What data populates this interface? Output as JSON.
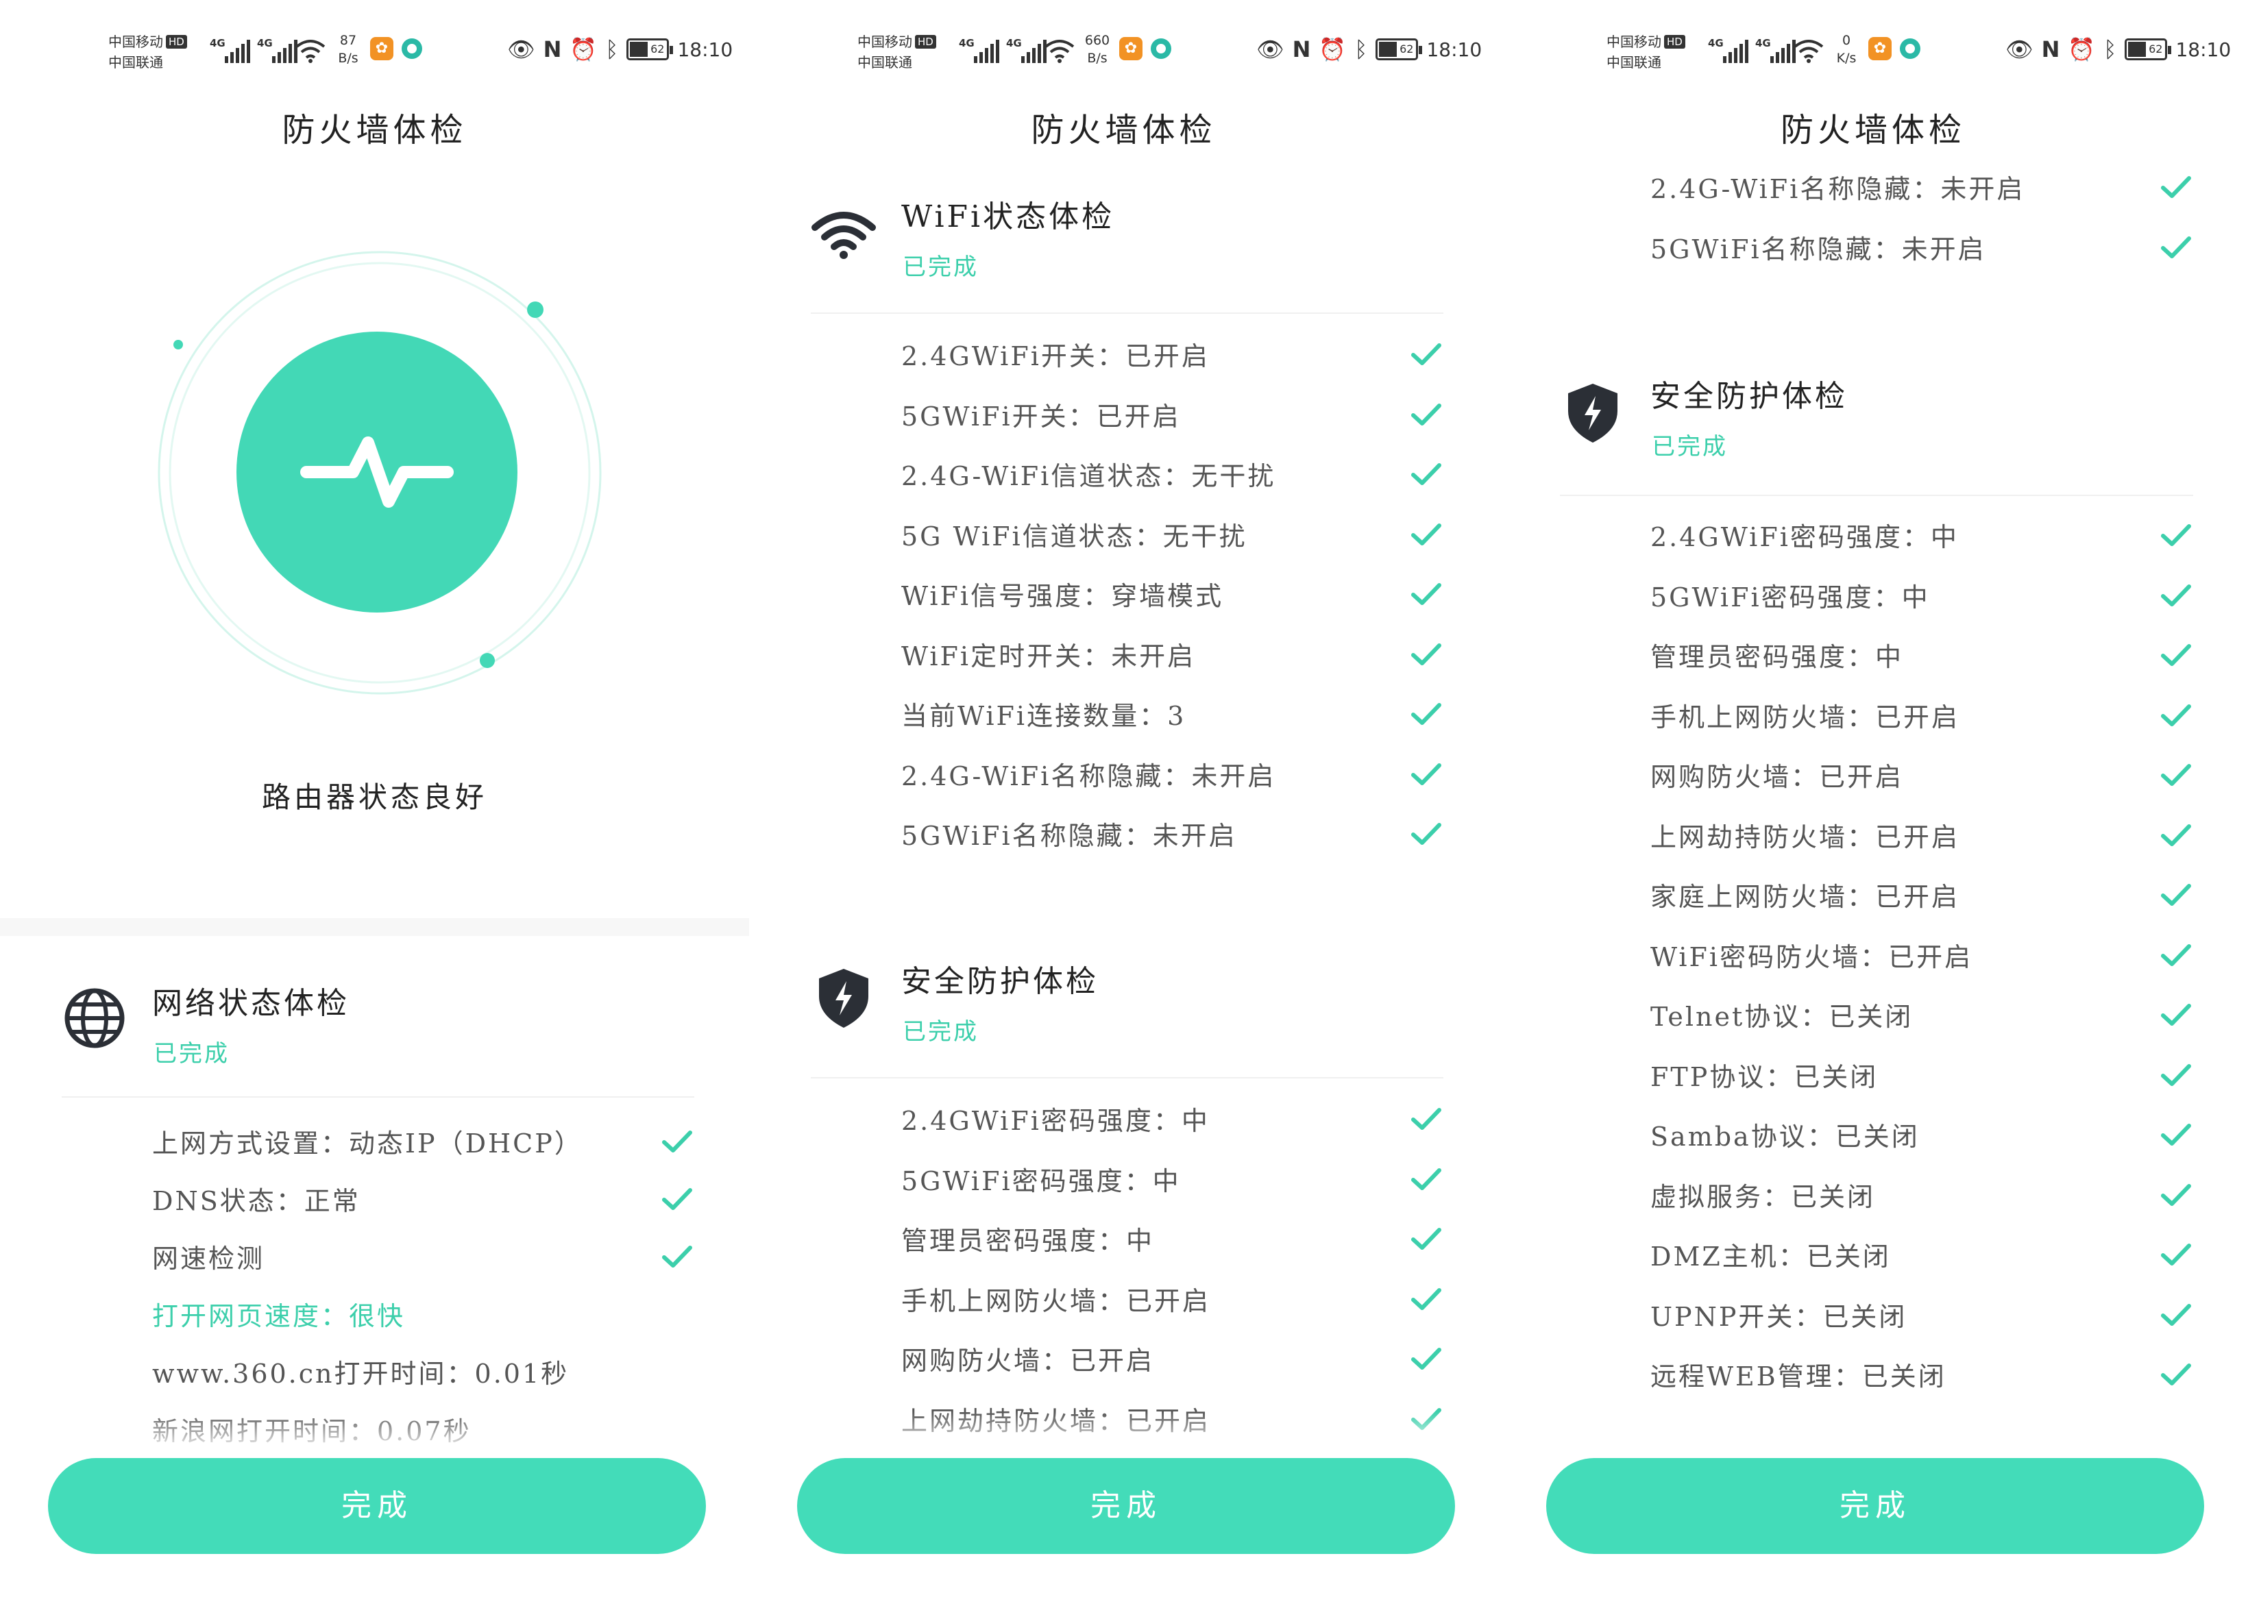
{
  "colors": {
    "accent": "#43d8b6",
    "accent_text": "#3ccfab",
    "check": "#3ccfab",
    "text": "#555555",
    "shield": "#2b2f36"
  },
  "status_bars": [
    {
      "carrier1": "中国移动",
      "carrier2": "中国联通",
      "hd": "HD",
      "net1": "4G",
      "net2": "4G",
      "speed_value": "87",
      "speed_unit": "B/s",
      "nfc": "N",
      "battery": "62",
      "time": "18:10"
    },
    {
      "carrier1": "中国移动",
      "carrier2": "中国联通",
      "hd": "HD",
      "net1": "4G",
      "net2": "4G",
      "speed_value": "660",
      "speed_unit": "B/s",
      "nfc": "N",
      "battery": "62",
      "time": "18:10"
    },
    {
      "carrier1": "中国移动",
      "carrier2": "中国联通",
      "hd": "HD",
      "net1": "4G",
      "net2": "4G",
      "speed_value": "0",
      "speed_unit": "K/s",
      "nfc": "N",
      "battery": "62",
      "time": "18:10"
    }
  ],
  "page_title": "防火墙体检",
  "router_status": "路由器状态良好",
  "done_label": "完成",
  "panel0": {
    "network_section": {
      "name": "网络状态体检",
      "state": "已完成",
      "icon": "globe-icon",
      "items": [
        {
          "text": "上网方式设置：动态IP（DHCP）",
          "checked": true
        },
        {
          "text": "DNS状态：正常",
          "checked": true
        },
        {
          "text": "网速检测",
          "checked": true
        },
        {
          "text": "打开网页速度：很快",
          "checked": false,
          "highlight": true
        },
        {
          "text": "www.360.cn打开时间：0.01秒",
          "checked": false
        },
        {
          "text": "新浪网打开时间：0.07秒",
          "checked": false
        }
      ]
    }
  },
  "panel1": {
    "wifi_section": {
      "name": "WiFi状态体检",
      "state": "已完成",
      "icon": "wifi-icon",
      "items": [
        "2.4GWiFi开关：已开启",
        "5GWiFi开关：已开启",
        "2.4G-WiFi信道状态：无干扰",
        "5G WiFi信道状态：无干扰",
        "WiFi信号强度：穿墙模式",
        "WiFi定时开关：未开启",
        "当前WiFi连接数量：3",
        "2.4G-WiFi名称隐藏：未开启",
        "5GWiFi名称隐藏：未开启"
      ]
    },
    "security_section": {
      "name": "安全防护体检",
      "state": "已完成",
      "icon": "shield-bolt-icon",
      "items": [
        "2.4GWiFi密码强度：中",
        "5GWiFi密码强度：中",
        "管理员密码强度：中",
        "手机上网防火墙：已开启",
        "网购防火墙：已开启",
        "上网劫持防火墙：已开启"
      ]
    }
  },
  "panel2": {
    "wifi_tail": [
      "2.4G-WiFi名称隐藏：未开启",
      "5GWiFi名称隐藏：未开启"
    ],
    "security_section": {
      "name": "安全防护体检",
      "state": "已完成",
      "icon": "shield-bolt-icon",
      "items": [
        "2.4GWiFi密码强度：中",
        "5GWiFi密码强度：中",
        "管理员密码强度：中",
        "手机上网防火墙：已开启",
        "网购防火墙：已开启",
        "上网劫持防火墙：已开启",
        "家庭上网防火墙：已开启",
        "WiFi密码防火墙：已开启",
        "Telnet协议：已关闭",
        "FTP协议：已关闭",
        "Samba协议：已关闭",
        "虚拟服务：已关闭",
        "DMZ主机：已关闭",
        "UPNP开关：已关闭",
        "远程WEB管理：已关闭"
      ]
    }
  }
}
